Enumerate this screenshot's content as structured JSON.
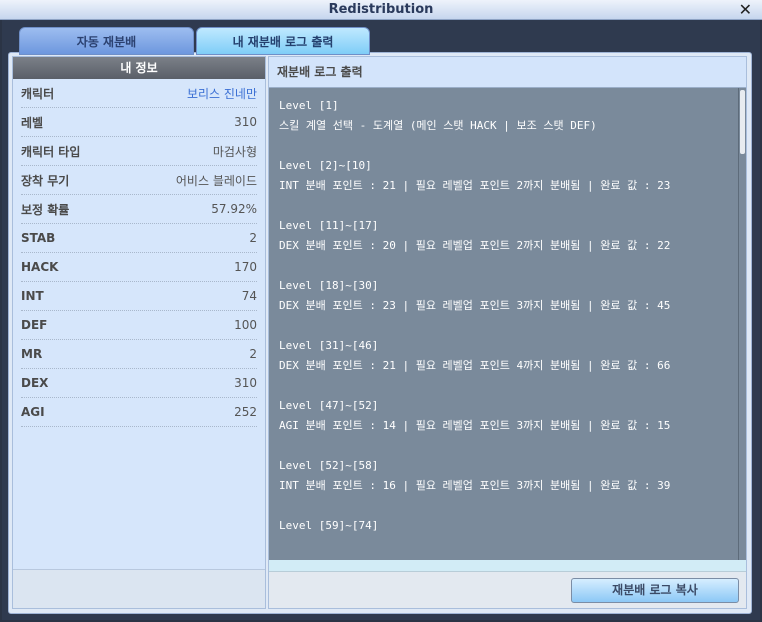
{
  "window": {
    "title": "Redistribution",
    "close": "✕"
  },
  "tabs": [
    {
      "label": "자동 재분배"
    },
    {
      "label": "내 재분배 로그 출력"
    }
  ],
  "info": {
    "header": "내 정보",
    "rows": [
      {
        "label": "캐릭터",
        "value": "보리스 진네만"
      },
      {
        "label": "레벨",
        "value": "310"
      },
      {
        "label": "캐릭터 타입",
        "value": "마검사형"
      },
      {
        "label": "장착 무기",
        "value": "어비스 블레이드"
      },
      {
        "label": "보정 확률",
        "value": "57.92%"
      },
      {
        "label": "STAB",
        "value": "2"
      },
      {
        "label": "HACK",
        "value": "170"
      },
      {
        "label": "INT",
        "value": "74"
      },
      {
        "label": "DEF",
        "value": "100"
      },
      {
        "label": "MR",
        "value": "2"
      },
      {
        "label": "DEX",
        "value": "310"
      },
      {
        "label": "AGI",
        "value": "252"
      }
    ]
  },
  "log": {
    "header": "재분배 로그 출력",
    "lines": [
      "Level [1]",
      "스킬 계열 선택 - 도계열 (메인 스탯 HACK | 보조 스탯 DEF)",
      "",
      "Level [2]~[10]",
      "INT 분배 포인트 : 21 | 필요 레벨업 포인트 2까지 분배됨 | 완료 값 : 23",
      "",
      "Level [11]~[17]",
      "DEX 분배 포인트 : 20 | 필요 레벨업 포인트 2까지 분배됨 | 완료 값 : 22",
      "",
      "Level [18]~[30]",
      "DEX 분배 포인트 : 23 | 필요 레벨업 포인트 3까지 분배됨 | 완료 값 : 45",
      "",
      "Level [31]~[46]",
      "DEX 분배 포인트 : 21 | 필요 레벨업 포인트 4까지 분배됨 | 완료 값 : 66",
      "",
      "Level [47]~[52]",
      "AGI 분배 포인트 : 14 | 필요 레벨업 포인트 3까지 분배됨 | 완료 값 : 15",
      "",
      "Level [52]~[58]",
      "INT 분배 포인트 : 16 | 필요 레벨업 포인트 3까지 분배됨 | 완료 값 : 39",
      "",
      "Level [59]~[74]"
    ],
    "copy_button": "재분배 로그 복사"
  }
}
